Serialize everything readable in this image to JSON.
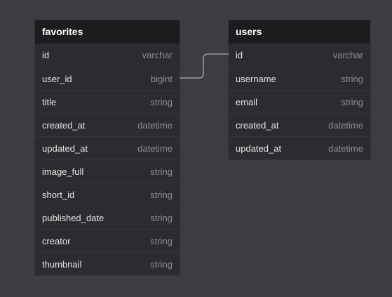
{
  "tables": [
    {
      "name": "favorites",
      "columns": [
        {
          "name": "id",
          "type": "varchar"
        },
        {
          "name": "user_id",
          "type": "bigint"
        },
        {
          "name": "title",
          "type": "string"
        },
        {
          "name": "created_at",
          "type": "datetime"
        },
        {
          "name": "updated_at",
          "type": "datetime"
        },
        {
          "name": "image_full",
          "type": "string"
        },
        {
          "name": "short_id",
          "type": "string"
        },
        {
          "name": "published_date",
          "type": "string"
        },
        {
          "name": "creator",
          "type": "string"
        },
        {
          "name": "thumbnail",
          "type": "string"
        }
      ]
    },
    {
      "name": "users",
      "columns": [
        {
          "name": "id",
          "type": "varchar"
        },
        {
          "name": "username",
          "type": "string"
        },
        {
          "name": "email",
          "type": "string"
        },
        {
          "name": "created_at",
          "type": "datetime"
        },
        {
          "name": "updated_at",
          "type": "datetime"
        }
      ]
    }
  ],
  "relationships": [
    {
      "from_table": "favorites",
      "from_column": "user_id",
      "to_table": "users",
      "to_column": "id"
    }
  ],
  "colors": {
    "canvas": "#3d3c42",
    "table_body": "#2c2c30",
    "table_header": "#1c1c1e",
    "column_name": "#e6e6e6",
    "column_type": "#8c8c92",
    "connector": "#c8c8cc"
  }
}
